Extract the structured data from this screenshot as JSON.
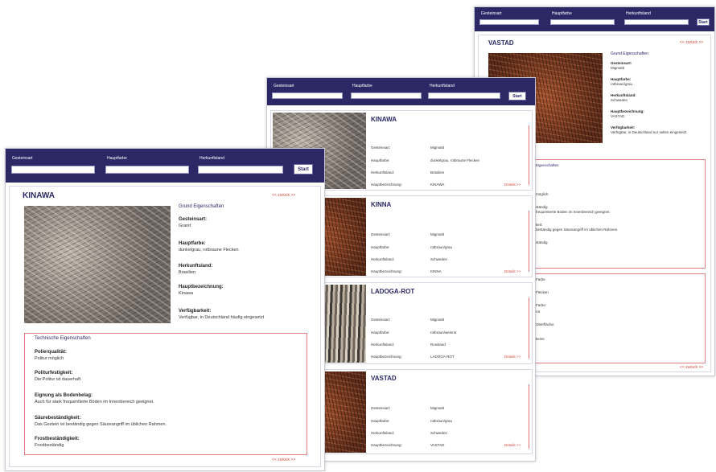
{
  "search": {
    "field1_label": "Gesteinsart",
    "field2_label": "Hauptfarbe",
    "field3_label": "Herkunftsland",
    "button": "Start"
  },
  "front": {
    "title": "KINAWA",
    "back": "<< zurück >>",
    "section": "Grund Eigenschaften",
    "props": [
      {
        "label": "Gesteinsart:",
        "value": "Granit"
      },
      {
        "label": "Hauptfarbe:",
        "value": "dunkelgrau, rotbraune Flecken"
      },
      {
        "label": "Herkunftsland:",
        "value": "Brasilien"
      },
      {
        "label": "Hauptbezeichnung:",
        "value": "Kinawa"
      },
      {
        "label": "Verfügbarkeit:",
        "value": "Verfügbar, in Deutschland häufig eingesetzt"
      }
    ],
    "tech_title": "Technische Eigenschaften",
    "tech": [
      {
        "label": "Polierqualität:",
        "value": "Politur möglich"
      },
      {
        "label": "Politurfestigkeit:",
        "value": "Die Politur ist dauerhaft"
      },
      {
        "label": "Eignung als Bodenbelag:",
        "value": "Auch für stark frequentierte Böden im Innenbereich geeignet."
      },
      {
        "label": "Säurebeständigkeit:",
        "value": "Das Gestein ist beständig gegen Säureangriff im üblichen Rahmen."
      },
      {
        "label": "Frostbeständigkeit:",
        "value": "Frostbeständig"
      }
    ],
    "back_bottom": "<< zurück >>"
  },
  "middle": {
    "cards": [
      {
        "title": "KINAWA",
        "rows": [
          {
            "l": "Gesteinsart:",
            "v": "Migmatit"
          },
          {
            "l": "Hauptfarbe:",
            "v": "dunkelgrau, rotbraune Flecken"
          },
          {
            "l": "Herkunftsland:",
            "v": "Brasilien"
          },
          {
            "l": "Hauptbezeichnung:",
            "v": "KINAWA"
          }
        ],
        "details": "Details >>"
      },
      {
        "title": "KINNA",
        "rows": [
          {
            "l": "Gesteinsart:",
            "v": "Migmatit"
          },
          {
            "l": "Hauptfarbe:",
            "v": "rotbraun/grau"
          },
          {
            "l": "Herkunftsland:",
            "v": "Schweden"
          },
          {
            "l": "Hauptbezeichnung:",
            "v": "KINNA"
          }
        ],
        "details": "Details >>"
      },
      {
        "title": "LADOGA-ROT",
        "rows": [
          {
            "l": "Gesteinsart:",
            "v": "Migmatit"
          },
          {
            "l": "Hauptfarbe:",
            "v": "rotbraun/weinrot"
          },
          {
            "l": "Herkunftsland:",
            "v": "Russland"
          },
          {
            "l": "Hauptbezeichnung:",
            "v": "LADOGA-ROT"
          }
        ],
        "details": "Details >>"
      },
      {
        "title": "VASTAD",
        "rows": [
          {
            "l": "Gesteinsart:",
            "v": "Migmatit"
          },
          {
            "l": "Hauptfarbe:",
            "v": "rotbraun/grau"
          },
          {
            "l": "Herkunftsland:",
            "v": "Schweden"
          },
          {
            "l": "Hauptbezeichnung:",
            "v": "VASTAD"
          }
        ],
        "details": "Details >>"
      }
    ]
  },
  "back_win": {
    "title": "VASTAD",
    "back": "<< zurück >>",
    "section": "Grund Eigenschaften",
    "props": [
      {
        "label": "Gesteinsart:",
        "value": "Migmatit"
      },
      {
        "label": "Hauptfarbe:",
        "value": "rotbraun/grau"
      },
      {
        "label": "Herkunftsland:",
        "value": "Schweden"
      },
      {
        "label": "Hauptbezeichnung:",
        "value": "VASTAD"
      },
      {
        "label": "Verfügbarkeit:",
        "value": "Verfügbar, in Deutschland nur selten eingesetzt"
      }
    ],
    "tech_frag": [
      "Eigenschaften",
      "möglich",
      "ständig",
      "frequentierte Böden im Innenbereich geeignet.",
      "keit:",
      "beständig gegen Säureangriff im üblichen Rahmen.",
      "ständig"
    ],
    "frag2": [
      "Farbe",
      "Flecken",
      "Farbe:",
      "rot",
      "Oberfläche:",
      "keine"
    ],
    "back_bottom": "<< zurück >>"
  },
  "colors": {
    "header": "#2c2866",
    "accent": "#d14a3c"
  }
}
